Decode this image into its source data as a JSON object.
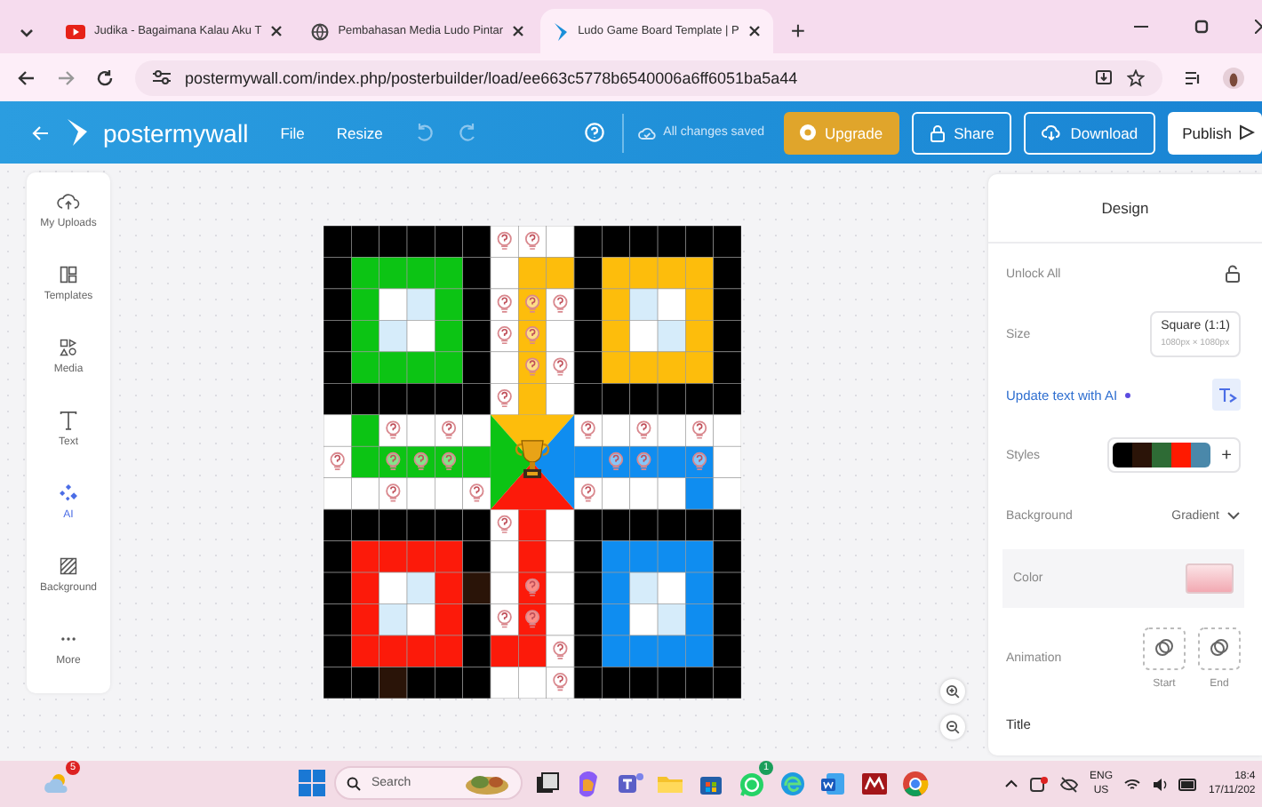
{
  "browser": {
    "tabs": [
      {
        "title": "Judika - Bagaimana Kalau Aku T",
        "selected": false
      },
      {
        "title": "Pembahasan Media Ludo Pintar",
        "selected": false
      },
      {
        "title": "Ludo Game Board Template | P",
        "selected": true
      }
    ],
    "new_tab": "+",
    "address": "postermywall.com/index.php/posterbuilder/load/ee663c5778b6540006a6ff6051ba5a44"
  },
  "toolbar": {
    "brand": "postermywall",
    "menu": [
      "File",
      "Resize"
    ],
    "status": "All changes saved",
    "buttons": [
      {
        "label": "Upgrade",
        "kind": "upgrade"
      },
      {
        "label": "Share",
        "kind": "share"
      },
      {
        "label": "Download",
        "kind": "download"
      },
      {
        "label": "Publish",
        "kind": "publish"
      }
    ]
  },
  "rail": [
    {
      "label": "My Uploads",
      "selected": false
    },
    {
      "label": "Templates",
      "selected": false
    },
    {
      "label": "Media",
      "selected": false
    },
    {
      "label": "Text",
      "selected": false
    },
    {
      "label": "AI",
      "selected": true
    },
    {
      "label": "Background",
      "selected": false
    },
    {
      "label": "More",
      "selected": false
    }
  ],
  "design_panel": {
    "title": "Design",
    "rows": [
      {
        "kind": "action",
        "label": "Unlock All"
      },
      {
        "kind": "size",
        "label": "Size",
        "value": "Square (1:1)",
        "detail": "1080px × 1080px"
      },
      {
        "kind": "ai",
        "label": "Update text with AI"
      },
      {
        "kind": "swatches",
        "label": "Styles",
        "add": "+",
        "swatches": [
          {
            "color": "#000000"
          },
          {
            "color": "#2b1408"
          },
          {
            "color": "#2e6b35"
          },
          {
            "color": "#ff1a00"
          },
          {
            "color": "#4a88aa"
          }
        ]
      },
      {
        "kind": "dropdown",
        "label": "Background",
        "value": "Gradient"
      },
      {
        "kind": "color",
        "label": "Color"
      },
      {
        "kind": "animation",
        "label": "Animation",
        "options": [
          "Start",
          "End"
        ]
      },
      {
        "kind": "section",
        "label": "Title"
      }
    ]
  },
  "taskbar": {
    "weather_badge": "5",
    "search_placeholder": "Search",
    "chat_badge": "1",
    "language": [
      "ENG",
      "US"
    ],
    "time": "18:4",
    "date": "17/11/202"
  }
}
